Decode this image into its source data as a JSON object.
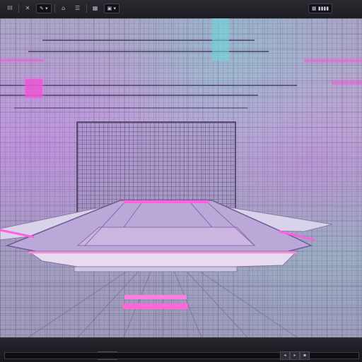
{
  "toolbar": {
    "left_buttons": [
      "III",
      "✕",
      "⌂",
      "☰",
      "▦"
    ],
    "field_1": "✎ ▾",
    "field_2": "▣ ▾",
    "right_label": "▦ ▮▮▮▮"
  },
  "icons": {
    "menu": "menu-icon",
    "close": "close-icon",
    "shield": "shield-icon",
    "list": "list-icon",
    "grid": "grid-icon",
    "play": "play-icon",
    "pause": "pause-icon"
  },
  "colors": {
    "accent_pink": "#ef56d6",
    "accent_cyan": "#7fd2d6",
    "viewport_bg": "#aaa6c7"
  },
  "timeline": {
    "left_buttons": [
      "◂",
      "▸"
    ],
    "right_buttons": [
      "◂",
      "▸",
      "▪"
    ]
  }
}
